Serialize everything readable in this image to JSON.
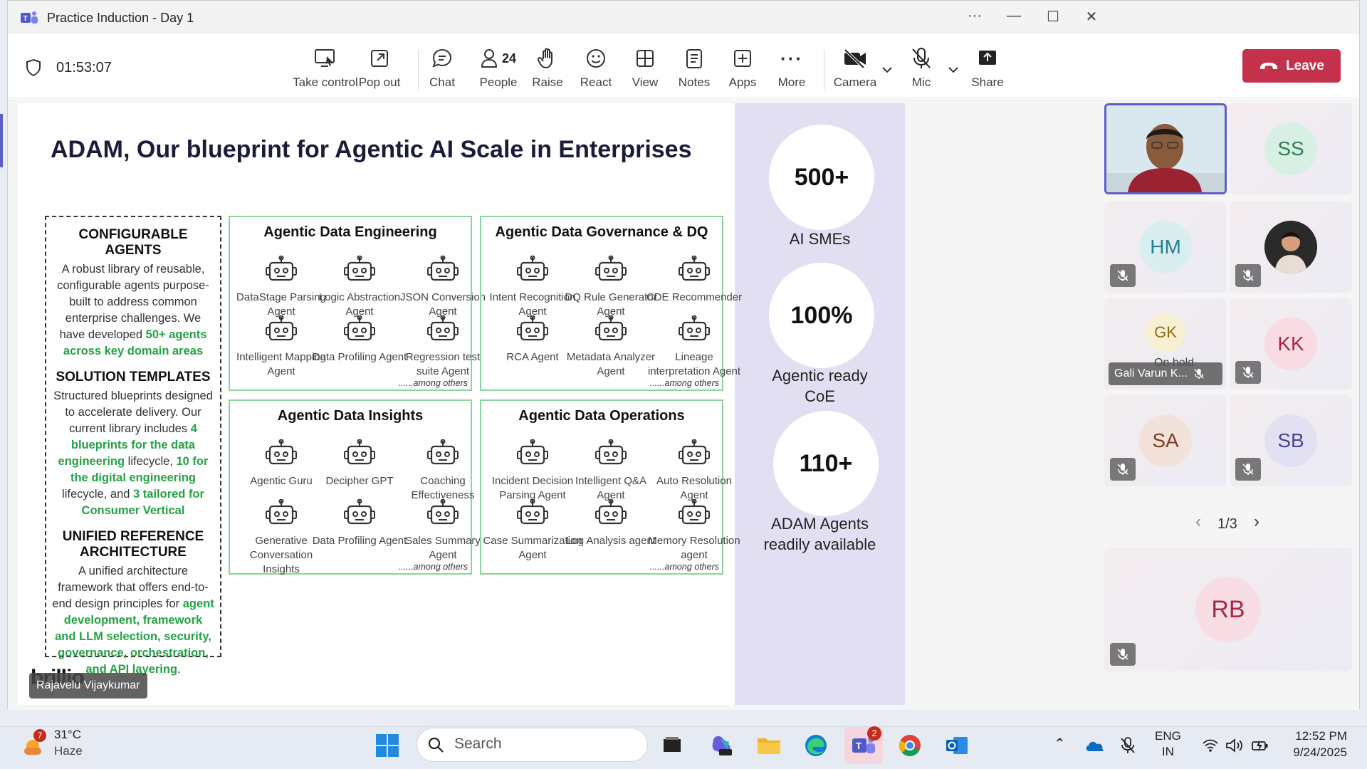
{
  "window": {
    "title": "Practice Induction - Day 1"
  },
  "meeting": {
    "timer": "01:53:07"
  },
  "toolbar": {
    "take_control": "Take control",
    "pop_out": "Pop out",
    "chat": "Chat",
    "people": "People",
    "people_count": "24",
    "raise": "Raise",
    "react": "React",
    "view": "View",
    "notes": "Notes",
    "apps": "Apps",
    "more": "More",
    "camera": "Camera",
    "mic": "Mic",
    "share": "Share",
    "leave": "Leave",
    "leave_color": "#c4314b"
  },
  "slide": {
    "title": "ADAM, Our blueprint for Agentic AI Scale in Enterprises",
    "left": {
      "h1": "CONFIGURABLE AGENTS",
      "p1a": "A robust library of reusable, configurable agents purpose-built to address common enterprise challenges. We have developed ",
      "p1b": "50+ agents across key domain areas",
      "h2": "SOLUTION TEMPLATES",
      "p2a": "Structured blueprints designed to accelerate delivery. Our current library includes ",
      "p2b": "4 blueprints for the data engineering",
      "p2c": " lifecycle, ",
      "p2d": "10 for the digital engineering",
      "p2e": " lifecycle, and ",
      "p2f": "3 tailored for Consumer Vertical",
      "h3": "UNIFIED REFERENCE ARCHITECTURE",
      "p3a": "A unified architecture framework that offers end-to-end design principles for ",
      "p3b": "agent development, framework and LLM selection, security, governance, orchestration, and API layering",
      "p3c": "."
    },
    "quadrants": [
      {
        "title": "Agentic Data Engineering",
        "among": "......among others",
        "agents": [
          "DataStage Parsing Agent",
          "Logic Abstraction Agent",
          "JSON Conversion Agent",
          "Intelligent Mapping Agent",
          "Data Profiling Agent",
          "Regression test suite Agent"
        ]
      },
      {
        "title": "Agentic Data Governance & DQ",
        "among": "......among others",
        "agents": [
          "Intent Recognition Agent",
          "DQ Rule Generator Agent",
          "CDE Recommender",
          "RCA Agent",
          "Metadata Analyzer Agent",
          "Lineage interpretation Agent"
        ]
      },
      {
        "title": "Agentic Data Insights",
        "among": "......among others",
        "agents": [
          "Agentic Guru",
          "Decipher GPT",
          "Coaching Effectiveness",
          "Generative Conversation Insights",
          "Data Profiling Agent",
          "Sales Summary Agent"
        ]
      },
      {
        "title": "Agentic Data Operations",
        "among": "......among others",
        "agents": [
          "Incident Decision Parsing Agent",
          "Intelligent Q&A Agent",
          "Auto Resolution Agent",
          "Case Summarization Agent",
          "Log Analysis agent",
          "Memory Resolution agent"
        ]
      }
    ],
    "stats": [
      {
        "value": "500+",
        "label": "AI SMEs"
      },
      {
        "value": "100%",
        "label": "Agentic ready CoE"
      },
      {
        "value": "110+",
        "label": "ADAM Agents readily available"
      }
    ],
    "brand": "brillio",
    "presenter": "Rajavelu Vijaykumar"
  },
  "participants": {
    "tiles": [
      {
        "initials": "SS",
        "bg": "#d8efe3",
        "fg": "#2e7d57"
      },
      {
        "initials": "HM",
        "bg": "#d9eef1",
        "fg": "#2a7e8c"
      },
      {
        "initials": "GK",
        "bg": "#f6efd2",
        "fg": "#8a6d12",
        "name": "Gali Varun K...",
        "status": "On hold"
      },
      {
        "initials": "KK",
        "bg": "#f8dbe3",
        "fg": "#a5284b"
      },
      {
        "initials": "SA",
        "bg": "#f2e2da",
        "fg": "#7a3f25"
      },
      {
        "initials": "SB",
        "bg": "#e2e0f3",
        "fg": "#4b4394"
      },
      {
        "initials": "RB",
        "bg": "#f9dde5",
        "fg": "#a5284b"
      }
    ],
    "pager": "1/3"
  },
  "taskbar": {
    "weather_temp": "31°C",
    "weather_desc": "Haze",
    "weather_badge": "7",
    "search": "Search",
    "teams_badge": "2",
    "lang1": "ENG",
    "lang2": "IN",
    "time": "12:52 PM",
    "date": "9/24/2025"
  }
}
